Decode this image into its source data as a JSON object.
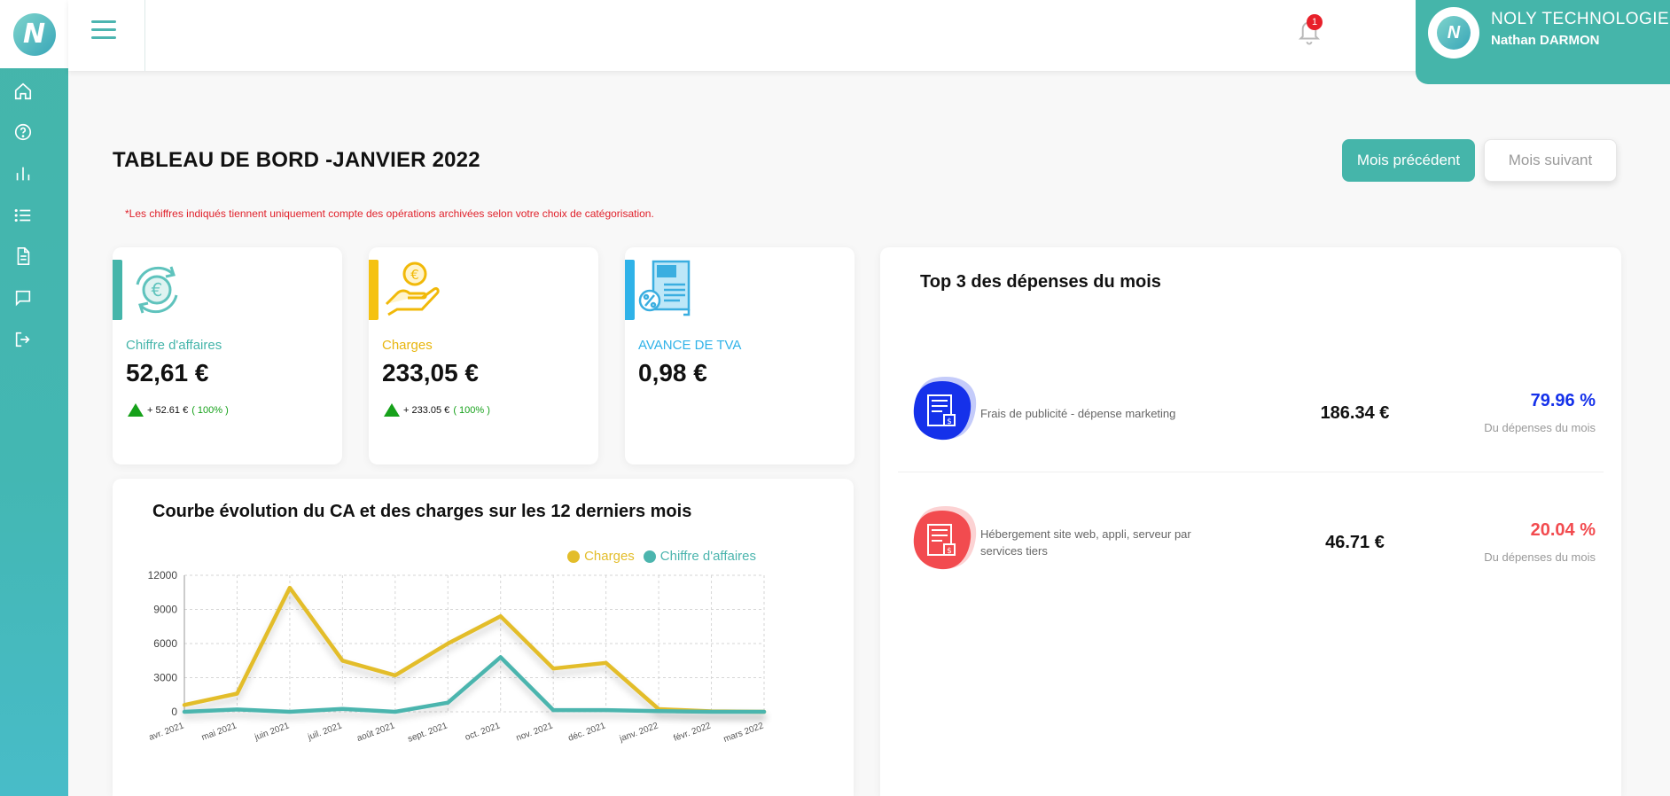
{
  "company": {
    "name": "NOLY TECHNOLOGIE",
    "user": "Nathan DARMON"
  },
  "notifications": {
    "count": "1"
  },
  "sidebar": {
    "items": [
      {
        "name": "home-icon"
      },
      {
        "name": "help-icon"
      },
      {
        "name": "bar-chart-icon"
      },
      {
        "name": "list-icon"
      },
      {
        "name": "document-icon"
      },
      {
        "name": "chat-icon"
      },
      {
        "name": "logout-icon"
      }
    ]
  },
  "header": {
    "title": "TABLEAU DE BORD -JANVIER 2022",
    "prev_label": "Mois précédent",
    "next_label": "Mois suivant",
    "note": "*Les chiffres indiqués tiennent uniquement compte des opérations archivées selon votre choix de catégorisation."
  },
  "kpis": [
    {
      "label": "Chiffre d'affaires",
      "value": "52,61 €",
      "delta": "+ 52.61 €",
      "delta_pct": "( 100% )",
      "color": "#45b5aa"
    },
    {
      "label": "Charges",
      "value": "233,05 €",
      "delta": "+ 233.05 €",
      "delta_pct": "( 100% )",
      "color": "#f5c211"
    },
    {
      "label": "AVANCE DE TVA",
      "value": "0,98 €",
      "color": "#2fb2e8"
    }
  ],
  "chart": {
    "title": "Courbe évolution du CA et des charges sur les 12 derniers mois"
  },
  "chart_data": {
    "type": "line",
    "categories": [
      "avr. 2021",
      "mai 2021",
      "juin 2021",
      "juil. 2021",
      "août 2021",
      "sept. 2021",
      "oct. 2021",
      "nov. 2021",
      "déc. 2021",
      "janv. 2022",
      "févr. 2022",
      "mars 2022"
    ],
    "series": [
      {
        "name": "Charges",
        "color": "#e3bd2a",
        "values": [
          600,
          1600,
          10900,
          4500,
          3200,
          6000,
          8400,
          3800,
          4300,
          233,
          40,
          0
        ]
      },
      {
        "name": "Chiffre d'affaires",
        "color": "#4cb5ae",
        "values": [
          0,
          200,
          0,
          250,
          0,
          800,
          4800,
          150,
          150,
          53,
          0,
          0
        ]
      }
    ],
    "yticks": [
      "12000",
      "9000",
      "6000",
      "3000",
      "0"
    ],
    "ylim": [
      0,
      12000
    ],
    "grid": true,
    "legend": "top-right"
  },
  "top3": {
    "title": "Top 3 des dépenses du mois",
    "items": [
      {
        "label": "Frais de publicité - dépense marketing",
        "amount": "186.34 €",
        "pct": "79.96 %",
        "sub": "Du dépenses du mois",
        "color": "#1531ea"
      },
      {
        "label": "Hébergement site web, appli, serveur par services tiers",
        "amount": "46.71 €",
        "pct": "20.04 %",
        "sub": "Du dépenses du mois",
        "color": "#f24b4f"
      }
    ]
  }
}
